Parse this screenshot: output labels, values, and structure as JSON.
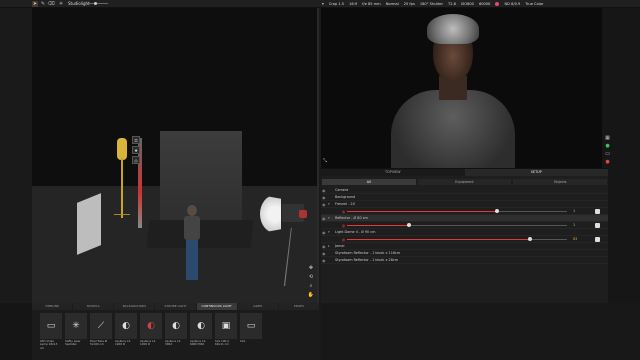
{
  "toolbar": {
    "studiolight_label": "Studiolight",
    "camera": [
      "Crop 1.5",
      "16:9",
      "f/e 85 mm",
      "Normal",
      "25 fps",
      "180° Shutter",
      "T2.8",
      "ISO800",
      "6000K",
      "ND 8/0.9",
      "True Color"
    ]
  },
  "panel": {
    "tabs": [
      "TOPVIEW",
      "SETUP"
    ],
    "active_tab": "SETUP",
    "subtabs": [
      "All",
      "Equipment",
      "Objects"
    ],
    "active_subtab": "All",
    "tree": [
      {
        "label": "Camera"
      },
      {
        "label": "Background"
      },
      {
        "label": "Fresnel - 2X"
      },
      {
        "label": "Reflector - Ø 80 cm"
      },
      {
        "label": "Light Dome II - Ø 90 cm"
      },
      {
        "label": "Jamal"
      },
      {
        "label": "Styrofoam Reflector - 1 block x 116cm"
      },
      {
        "label": "Styrofoam Reflector - 1 block x 28cm"
      }
    ],
    "sliders": [
      {
        "value": 0.68,
        "display": "1"
      },
      {
        "value": 0.28,
        "display": "1"
      },
      {
        "value": 0.83,
        "display": "83"
      }
    ]
  },
  "library": {
    "tabs": [
      "TIMELINE",
      "MODELS",
      "BACKGROUNDS",
      "STROBE LIGHT",
      "CONTINUOUS LIGHT",
      "GRIPS",
      "PROPS"
    ],
    "active_tab": "CONTINUOUS LIGHT",
    "items": [
      {
        "name": "LED Video Lamp 18x13 cm",
        "icon": "panel-icon"
      },
      {
        "name": "Softly Gear Spotstar",
        "icon": "starburst-icon"
      },
      {
        "name": "Pixel Tube Ø 5x100 cm",
        "icon": "tube-icon"
      },
      {
        "name": "Aputure LS 1200 D",
        "icon": "cob-icon"
      },
      {
        "name": "Aputure LS 1200 D",
        "icon": "cob-red-icon"
      },
      {
        "name": "Aputure LS 300X",
        "icon": "cob-icon"
      },
      {
        "name": "Aputure LS 600D PRO",
        "icon": "cob-icon"
      },
      {
        "name": "SLS 100-C 60x11 cm",
        "icon": "square-panel-icon"
      },
      {
        "name": "SLS",
        "icon": "panel-icon"
      }
    ]
  }
}
